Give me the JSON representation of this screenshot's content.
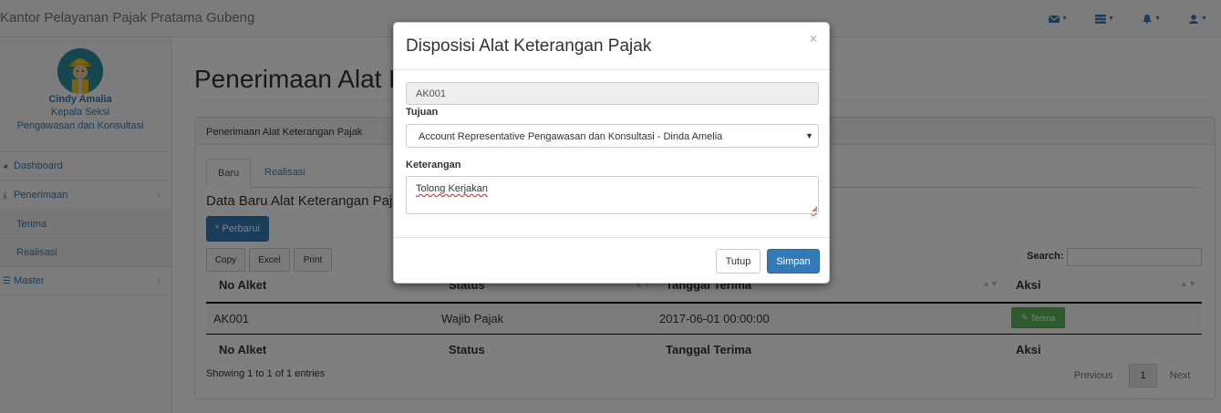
{
  "app": {
    "title": "Kantor Pelayanan Pajak Pratama Gubeng"
  },
  "navbar": {
    "icons": [
      "envelope-icon",
      "tasks-icon",
      "bell-icon",
      "user-icon"
    ]
  },
  "sidebar": {
    "user_name": "Cindy Amalia",
    "user_role": "Kepala Seksi",
    "user_division": "Pengawasan dan Konsultasi",
    "items": [
      {
        "label": "Dashboard",
        "icon": "dashboard-icon"
      },
      {
        "label": "Penerimaan",
        "icon": "download-icon"
      },
      {
        "label": "Terima"
      },
      {
        "label": "Realisasi"
      },
      {
        "label": "Master",
        "icon": "list-icon"
      }
    ]
  },
  "main": {
    "page_title": "Penerimaan Alat Keterangan Pajak",
    "panel_heading": "Penerimaan Alat Keterangan Pajak",
    "tabs": [
      {
        "label": "Baru"
      },
      {
        "label": "Realisasi"
      }
    ],
    "section_title": "Data Baru Alat Keterangan Pajak",
    "refresh_button": "* Perbarui",
    "export_buttons": [
      "Copy",
      "Excel",
      "Print"
    ],
    "search_label": "Search:",
    "table": {
      "columns": [
        "No Alket",
        "Status",
        "Tanggal Terima",
        "Aksi"
      ],
      "rows": [
        {
          "no_alket": "AK001",
          "status": "Wajib Pajak",
          "tanggal": "2017-06-01 00:00:00",
          "aksi": "Terima"
        }
      ]
    },
    "info": "Showing 1 to 1 of 1 entries",
    "pagination": {
      "previous": "Previous",
      "current": "1",
      "next": "Next"
    }
  },
  "modal": {
    "title": "Disposisi Alat Keterangan Pajak",
    "close": "×",
    "no_alket_value": "AK001",
    "tujuan_label": "Tujuan",
    "tujuan_value": "Account Representative Pengawasan dan Konsultasi - Dinda Amelia",
    "keterangan_label": "Keterangan",
    "keterangan_value": "Tolong Kerjakan",
    "cancel_label": "Tutup",
    "save_label": "Simpan"
  }
}
